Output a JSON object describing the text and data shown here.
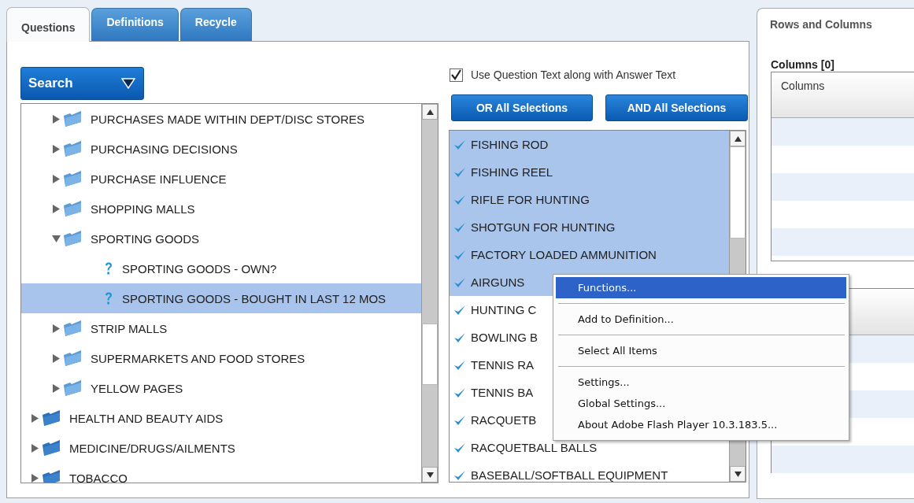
{
  "tabs": [
    {
      "label": "Questions",
      "selected": true
    },
    {
      "label": "Definitions",
      "selected": false
    },
    {
      "label": "Recycle",
      "selected": false
    }
  ],
  "search": {
    "label": "Search"
  },
  "tree": {
    "items": [
      {
        "children": [
          {
            "label": "PURCHASES MADE WITHIN DEPT/DISC STORES",
            "kind": "folder",
            "expanded": false,
            "selected": false
          },
          {
            "label": "PURCHASING DECISIONS",
            "kind": "folder",
            "expanded": false,
            "selected": false
          },
          {
            "label": "PURCHASE INFLUENCE",
            "kind": "folder",
            "expanded": false,
            "selected": false
          },
          {
            "label": "SHOPPING MALLS",
            "kind": "folder",
            "expanded": false,
            "selected": false
          },
          {
            "label": "SPORTING GOODS",
            "kind": "folder",
            "expanded": true,
            "selected": false,
            "children": [
              {
                "label": "SPORTING GOODS - OWN?",
                "kind": "question",
                "selected": false
              },
              {
                "label": "SPORTING GOODS - BOUGHT IN LAST 12 MOS",
                "kind": "question",
                "selected": true
              }
            ]
          },
          {
            "label": "STRIP MALLS",
            "kind": "folder",
            "expanded": false,
            "selected": false
          },
          {
            "label": "SUPERMARKETS AND FOOD STORES",
            "kind": "folder",
            "expanded": false,
            "selected": false
          },
          {
            "label": "YELLOW PAGES",
            "kind": "folder",
            "expanded": false,
            "selected": false
          }
        ]
      },
      {
        "label": "HEALTH AND BEAUTY AIDS",
        "kind": "folder",
        "expanded": false,
        "selected": false
      },
      {
        "label": "MEDICINE/DRUGS/AILMENTS",
        "kind": "folder",
        "expanded": false,
        "selected": false
      },
      {
        "label": "TOBACCO",
        "kind": "folder",
        "expanded": false,
        "selected": false
      }
    ]
  },
  "use_question_text": {
    "label": "Use Question Text along with Answer Text",
    "checked": true
  },
  "buttons": [
    "OR All Selections",
    "AND All Selections"
  ],
  "answers": {
    "items": [
      {
        "label": "FISHING ROD",
        "checked": true,
        "selected": true
      },
      {
        "label": "FISHING REEL",
        "checked": true,
        "selected": true
      },
      {
        "label": "RIFLE FOR HUNTING",
        "checked": true,
        "selected": true
      },
      {
        "label": "SHOTGUN FOR HUNTING",
        "checked": true,
        "selected": true
      },
      {
        "label": "FACTORY LOADED AMMUNITION",
        "checked": true,
        "selected": true
      },
      {
        "label": "AIRGUNS",
        "checked": true,
        "selected": true
      },
      {
        "label": "HUNTING C",
        "checked": true,
        "selected": false
      },
      {
        "label": "BOWLING B",
        "checked": true,
        "selected": false
      },
      {
        "label": "TENNIS RA",
        "checked": true,
        "selected": false
      },
      {
        "label": "TENNIS BA",
        "checked": true,
        "selected": false
      },
      {
        "label": "RACQUETB",
        "checked": true,
        "selected": false
      },
      {
        "label": "RACQUETBALL BALLS",
        "checked": true,
        "selected": false
      },
      {
        "label": "BASEBALL/SOFTBALL EQUIPMENT",
        "checked": true,
        "selected": false
      }
    ]
  },
  "context_menu": {
    "groups": [
      {
        "items": [
          {
            "label": "Functions...",
            "selected": true
          }
        ]
      },
      {
        "items": [
          {
            "label": "Add to Definition...",
            "selected": false
          }
        ]
      },
      {
        "items": [
          {
            "label": "Select All Items",
            "selected": false
          }
        ]
      },
      {
        "items": [
          {
            "label": "Settings...",
            "selected": false
          },
          {
            "label": "Global Settings...",
            "selected": false
          },
          {
            "label": "About Adobe Flash Player 10.3.183.5...",
            "selected": false
          }
        ]
      }
    ]
  },
  "rows_and_columns": {
    "title": "Rows and Columns",
    "columns_label": "Columns [0]",
    "columns_header": "Columns"
  }
}
